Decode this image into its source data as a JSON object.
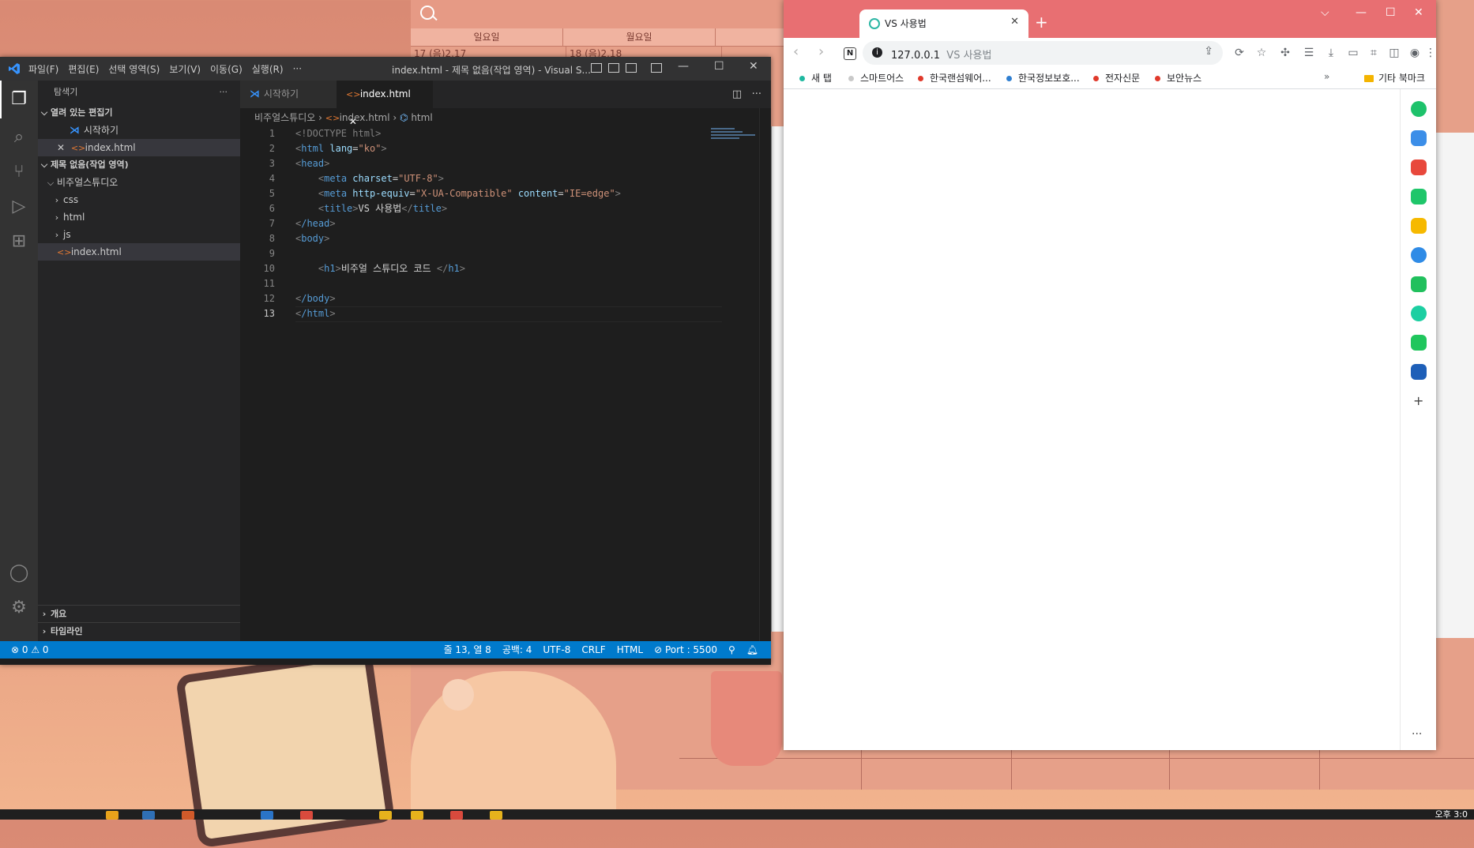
{
  "desktop": {
    "calendar_days": [
      "일요일",
      "월요일"
    ],
    "calendar_dates": [
      "17 (음)2.17",
      "18 (음)2.18"
    ],
    "clock": "오후 3:0"
  },
  "vscode": {
    "menu": [
      "파일(F)",
      "편집(E)",
      "선택 영역(S)",
      "보기(V)",
      "이동(G)",
      "실행(R)",
      "···"
    ],
    "window_title": "index.html - 제목 없음(작업 영역) - Visual S...",
    "explorer": {
      "title": "탐색기",
      "open_editors_header": "열려 있는 편집기",
      "open_editors": [
        "시작하기",
        "index.html"
      ],
      "workspace_header": "제목 없음(작업 영역)",
      "root_folder": "비주얼스튜디오",
      "folders": [
        "css",
        "html",
        "js"
      ],
      "file": "index.html",
      "outline": "개요",
      "timeline": "타임라인"
    },
    "tabs": [
      "시작하기",
      "index.html"
    ],
    "breadcrumb": {
      "folder": "비주얼스튜디오",
      "file": "index.html",
      "symbol": "html"
    },
    "code": {
      "l1": "<!DOCTYPE html>",
      "l2_tag": "html",
      "l2_attr": "lang",
      "l2_val": "\"ko\"",
      "l3": "head",
      "l4_tag": "meta",
      "l4_attr": "charset",
      "l4_val": "\"UTF-8\"",
      "l5_tag": "meta",
      "l5_attr1": "http-equiv",
      "l5_val1": "\"X-UA-Compatible\"",
      "l5_attr2": "content",
      "l5_val2": "\"IE=edge\"",
      "l6_tag": "title",
      "l6_text": "VS 사용법",
      "l7": "/head",
      "l8": "body",
      "l10_tag": "h1",
      "l10_text": "비주얼 스튜디오 코드 ",
      "l12": "/body",
      "l13": "/html"
    },
    "line_numbers": [
      "1",
      "2",
      "3",
      "4",
      "5",
      "6",
      "7",
      "8",
      "9",
      "10",
      "11",
      "12",
      "13"
    ],
    "status": {
      "problems": "⊗ 0 ⚠ 0",
      "position": "줄 13, 열 8",
      "spaces": "공백: 4",
      "encoding": "UTF-8",
      "eol": "CRLF",
      "language": "HTML",
      "port": "⊘ Port : 5500"
    }
  },
  "chrome": {
    "tab_title": "VS 사용법",
    "url": "127.0.0.1",
    "url_title": "VS 사용법",
    "bookmarks": [
      {
        "label": "새 탭",
        "color": "#1fb8a0"
      },
      {
        "label": "스마트어스",
        "color": "#c9c9c9"
      },
      {
        "label": "한국랜섬웨어...",
        "color": "#e0392b"
      },
      {
        "label": "한국정보보호...",
        "color": "#2f7fd1"
      },
      {
        "label": "전자신문",
        "color": "#e0392b"
      },
      {
        "label": "보안뉴스",
        "color": "#e0392b"
      }
    ],
    "other_bookmarks": "기타 북마크",
    "colors": {
      "titlebar": "#e86f72",
      "accent": "#2bb6a4"
    }
  }
}
